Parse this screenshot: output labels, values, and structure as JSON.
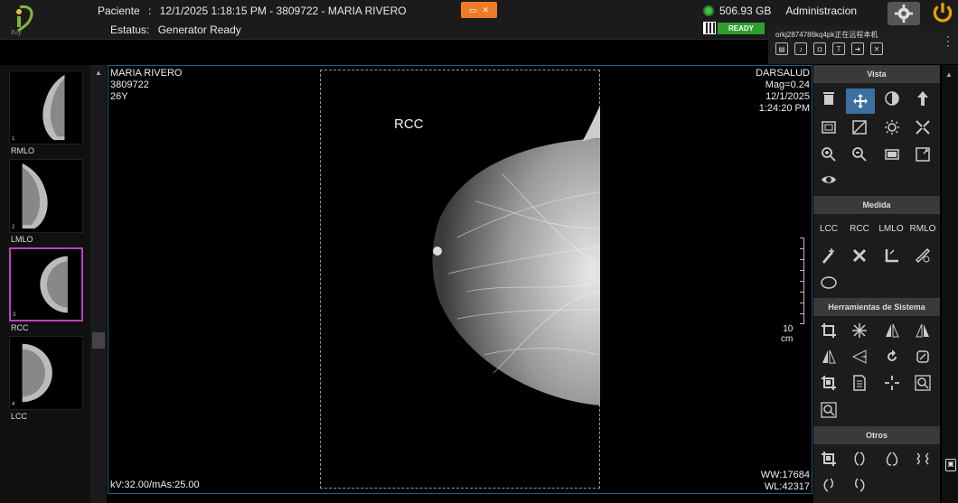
{
  "header": {
    "patient_label": "Paciente",
    "patient_sep": ":",
    "patient_datetime": "12/1/2025 1:18:15 PM",
    "patient_dash1": "-",
    "patient_id": "3809722",
    "patient_dash2": "-",
    "patient_name": "MARIA RIVERO",
    "status_label": "Estatus:",
    "status_value": "Generator Ready",
    "disk_space": "506.93 GB",
    "user": "Administracion",
    "ready_badge": "READY"
  },
  "remote": {
    "title": "orkj2874786kq4pk正在远程本机",
    "icons": [
      "chat-icon",
      "mic-icon",
      "camera-icon",
      "text-icon",
      "file-transfer-icon",
      "close-icon"
    ]
  },
  "thumbnails": [
    {
      "num": "1",
      "label": "RMLO"
    },
    {
      "num": "2",
      "label": "LMLO"
    },
    {
      "num": "3",
      "label": "RCC"
    },
    {
      "num": "4",
      "label": "LCC"
    }
  ],
  "viewport": {
    "top_left": [
      "MARIA RIVERO",
      "3809722",
      "26Y"
    ],
    "top_right": [
      "DARSALUD",
      "Mag=0.24",
      "12/1/2025",
      "1:24:20 PM"
    ],
    "view_label": "RCC",
    "ruler_value": "10",
    "ruler_unit": "cm",
    "bottom_left": "kV:32.00/mAs:25.00",
    "bottom_right": [
      "WW:17684",
      "WL:42317"
    ]
  },
  "panel": {
    "sections": {
      "vista": "Vista",
      "medida": "Medida",
      "herramientas": "Herramientas de Sistema",
      "otros": "Otros"
    },
    "view_buttons": [
      "LCC",
      "RCC",
      "LMLO",
      "RMLO"
    ]
  },
  "colors": {
    "accent_active": "#3b6f9f",
    "selected_thumb": "#c040c0",
    "ready_green": "#2e9f2e",
    "header_orange": "#f07c2a"
  }
}
